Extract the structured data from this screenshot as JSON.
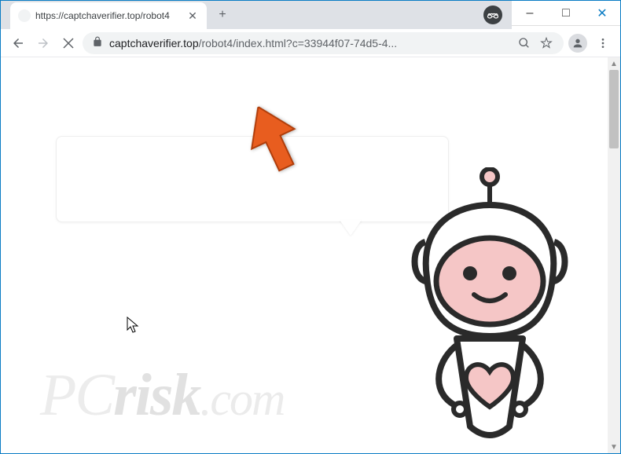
{
  "window": {
    "title_controls": {
      "minimize": "–",
      "maximize": "□",
      "close": "✕"
    }
  },
  "tab": {
    "title": "https://captchaverifier.top/robot4",
    "close_label": "✕"
  },
  "newtab": {
    "label": "+"
  },
  "nav": {
    "back": "←",
    "forward": "→",
    "reload_stop": "✕"
  },
  "url": {
    "domain": "captchaverifier.top",
    "path": "/robot4/index.html?c=33944f07-74d5-4..."
  },
  "omni": {
    "search": "⊕",
    "star": "☆"
  },
  "speech_text": "",
  "watermark": {
    "pc": "PC",
    "risk": "risk",
    "com": ".com"
  },
  "scrollbar": {
    "up": "▲",
    "down": "▼"
  }
}
